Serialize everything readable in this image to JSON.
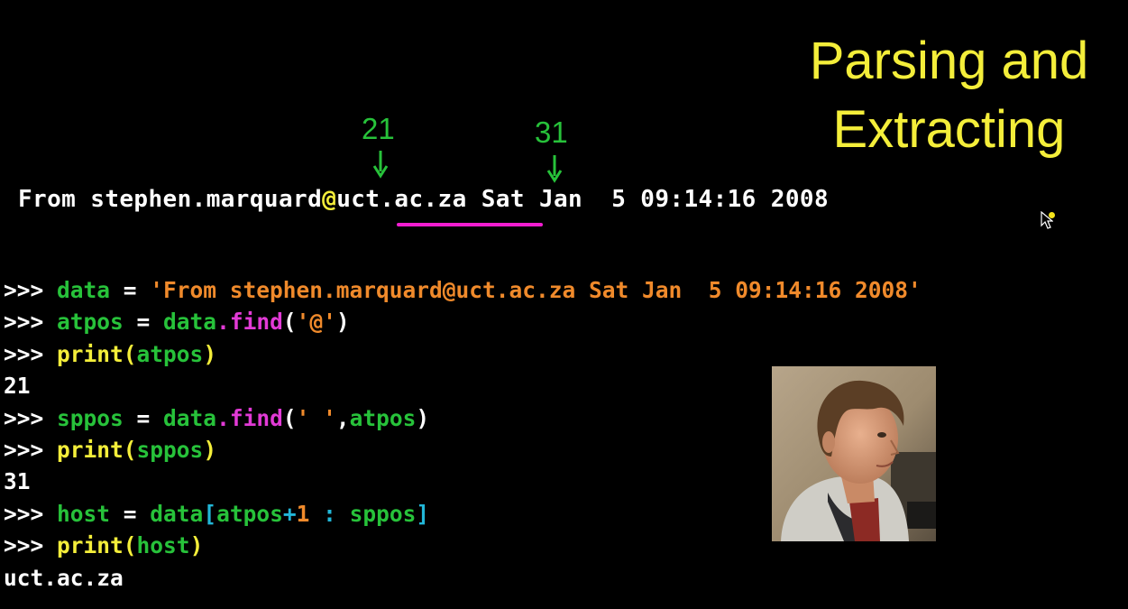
{
  "title": {
    "line1": "Parsing and",
    "line2": "Extracting"
  },
  "markers": {
    "at_index": "21",
    "space_index": "31"
  },
  "from_line": {
    "before": "From stephen.marquard",
    "at": "@",
    "host": "uct.ac.za",
    "after": " Sat Jan  5 09:14:16 2008"
  },
  "repl": {
    "prompt": ">>> ",
    "l1": {
      "var": "data",
      "eq": " = ",
      "str": "'From stephen.marquard@uct.ac.za Sat Jan  5 09:14:16 2008'"
    },
    "l2": {
      "var": "atpos",
      "eq": " = ",
      "obj": "data",
      "dot": ".",
      "fn": "find",
      "open": "(",
      "arg": "'@'",
      "close": ")"
    },
    "l3": {
      "fn": "print",
      "open": "(",
      "arg": "atpos",
      "close": ")"
    },
    "o1": "21",
    "l4": {
      "var": "sppos",
      "eq": " = ",
      "obj": "data",
      "dot": ".",
      "fn": "find",
      "open": "(",
      "arg1": "' '",
      "comma": ",",
      "arg2": "atpos",
      "close": ")"
    },
    "l5": {
      "fn": "print",
      "open": "(",
      "arg": "sppos",
      "close": ")"
    },
    "o2": "31",
    "l6": {
      "var": "host",
      "eq": " = ",
      "obj": "data",
      "lb": "[",
      "start": "atpos",
      "plus": "+",
      "one": "1",
      "colon": " : ",
      "end": "sppos",
      "rb": "]"
    },
    "l7": {
      "fn": "print",
      "open": "(",
      "arg": "host",
      "close": ")"
    },
    "o3": "uct.ac.za"
  },
  "colors": {
    "background": "#000000",
    "title": "#f4ee3a",
    "marker": "#27c23a",
    "underline": "#f21dd1",
    "variable": "#27c23a",
    "string": "#f08a2b",
    "method": "#e23ad6",
    "builtin": "#f4ee3a",
    "bracket": "#22b7d8"
  },
  "icons": {
    "arrow": "down-arrow-icon",
    "cursor": "mouse-pointer-icon"
  }
}
